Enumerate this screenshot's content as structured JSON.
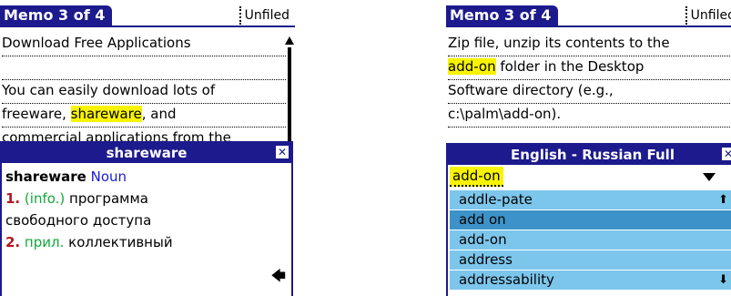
{
  "left": {
    "title": "Memo 3 of 4",
    "category": "Unfiled",
    "memo_lines": [
      {
        "parts": [
          {
            "text": "Download Free Applications",
            "hl": false
          }
        ]
      },
      {
        "parts": [
          {
            "text": "",
            "hl": false
          }
        ]
      },
      {
        "parts": [
          {
            "text": "You can easily download lots of",
            "hl": false
          }
        ]
      },
      {
        "parts": [
          {
            "text": "freeware, ",
            "hl": false
          },
          {
            "text": "shareware",
            "hl": true
          },
          {
            "text": ", and",
            "hl": false
          }
        ]
      },
      {
        "parts": [
          {
            "text": "commercial applications from the",
            "hl": false
          }
        ]
      }
    ],
    "popup": {
      "title": "shareware",
      "headword": "shareware",
      "pos": "Noun",
      "sense1_num": "1.",
      "sense1_tag": "(info.)",
      "sense1_text": "программа",
      "sense1_cont": "свободного доступа",
      "sense2_num": "2.",
      "sense2_tag": "прил.",
      "sense2_text": "коллективный"
    }
  },
  "right": {
    "title": "Memo 3 of 4",
    "category": "Unfiled",
    "memo_lines": [
      {
        "parts": [
          {
            "text": "Zip file, unzip its contents to the",
            "hl": false
          }
        ]
      },
      {
        "parts": [
          {
            "text": "add-on",
            "hl": true
          },
          {
            "text": " folder in the Desktop",
            "hl": false
          }
        ]
      },
      {
        "parts": [
          {
            "text": "Software directory (e.g.,",
            "hl": false
          }
        ]
      },
      {
        "parts": [
          {
            "text": "c:\\palm\\add-on).",
            "hl": false
          }
        ]
      },
      {
        "parts": [
          {
            "text": "",
            "hl": false
          }
        ]
      }
    ],
    "popup": {
      "title": "English - Russian Full",
      "input_value": "add-on",
      "results": [
        {
          "label": "addle-pate",
          "selected": false,
          "arrow": "up"
        },
        {
          "label": "add on",
          "selected": true,
          "arrow": ""
        },
        {
          "label": "add-on",
          "selected": false,
          "arrow": ""
        },
        {
          "label": "address",
          "selected": false,
          "arrow": ""
        },
        {
          "label": "addressability",
          "selected": false,
          "arrow": "down"
        }
      ]
    }
  },
  "colors": {
    "title_bar": "#1c1a8c",
    "highlight": "#f8f400",
    "list_item": "#7cc6ec",
    "list_selected": "#3d93c9"
  },
  "icons": {
    "close": "close-box-icon",
    "back": "back-arrow-icon",
    "dropdown": "triangle-down-icon",
    "scroll_up": "scroll-up-arrow-icon",
    "scroll_down": "scroll-down-arrow-icon"
  }
}
